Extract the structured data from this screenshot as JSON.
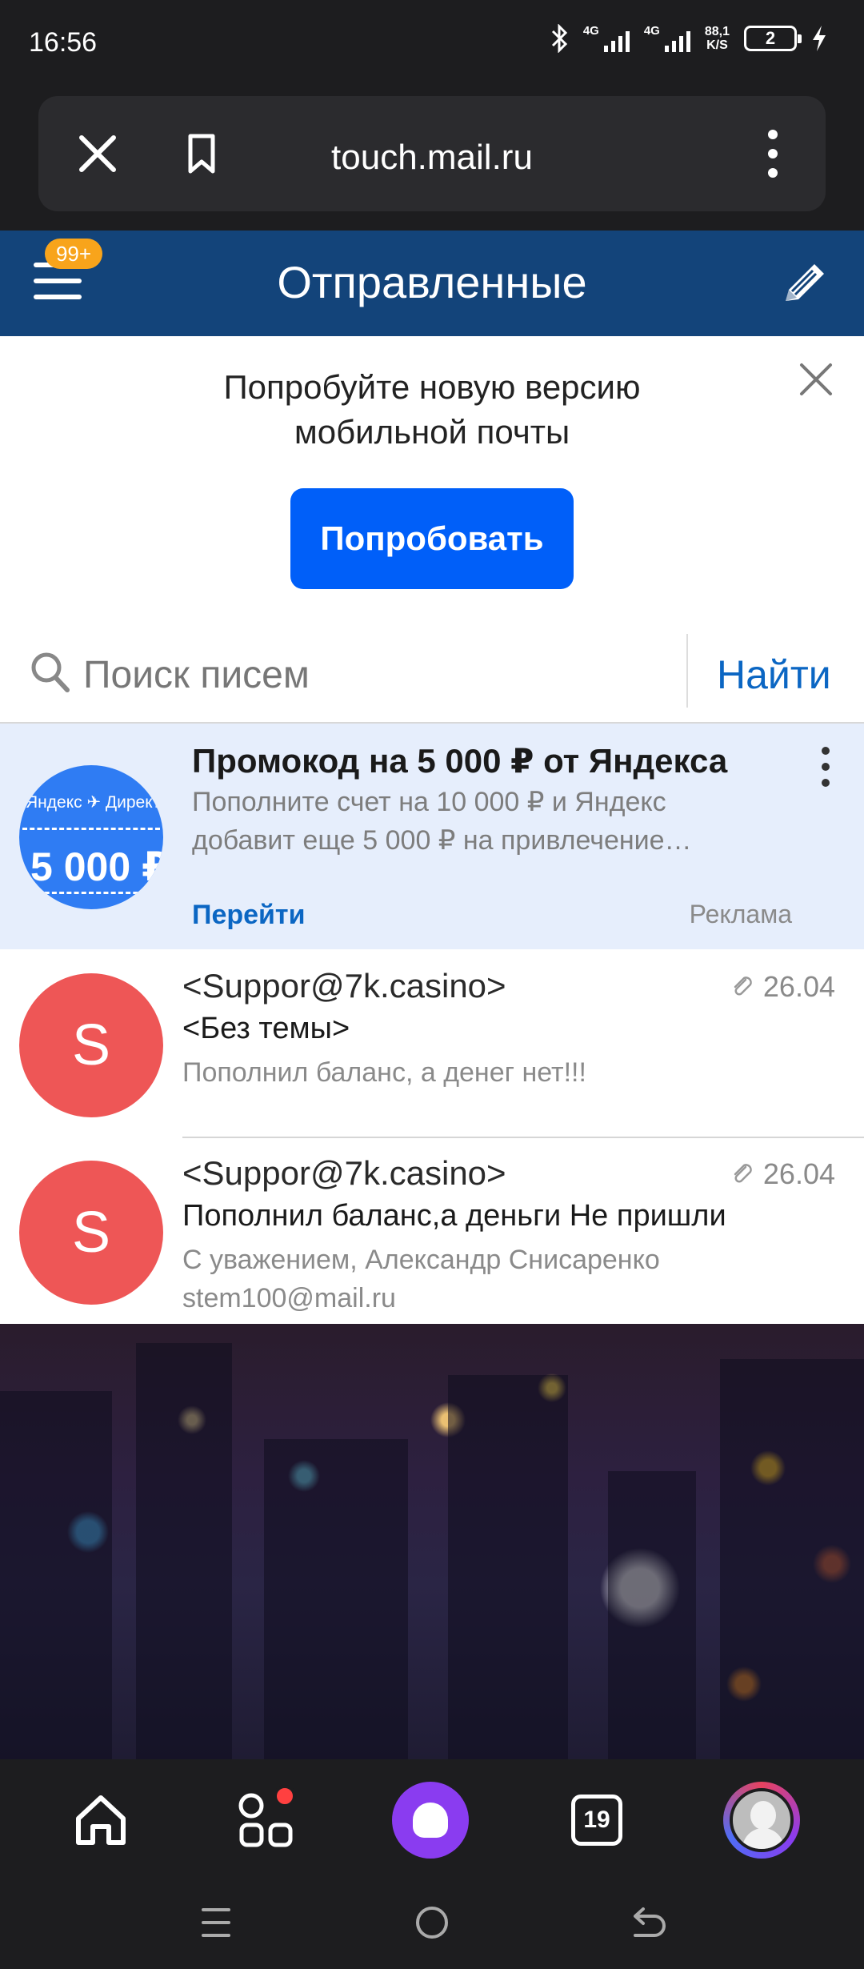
{
  "status_bar": {
    "time": "16:56",
    "network_1": "4G",
    "network_2": "4G",
    "speed_value": "88,1",
    "speed_unit": "K/S",
    "battery": "2"
  },
  "browser": {
    "url": "touch.mail.ru"
  },
  "header": {
    "badge": "99+",
    "title": "Отправленные",
    "color": "#13447a"
  },
  "promo": {
    "line1": "Попробуйте новую версию",
    "line2": "мобильной почты",
    "button": "Попробовать"
  },
  "search": {
    "placeholder": "Поиск писем",
    "button": "Найти"
  },
  "ad": {
    "thumb_brand": "Яндекс ✈ Директ",
    "thumb_amount": "5 000 ₽",
    "title": "Промокод на 5 000 ₽ от Яндекса",
    "text": "Пополните счет на 10 000 ₽ и Яндекс добавит еще 5 000 ₽ на привлечение…",
    "link": "Перейти",
    "label": "Реклама"
  },
  "messages": [
    {
      "avatar_letter": "S",
      "from": "<Suppor@7k.casino>",
      "date": "26.04",
      "subject": "<Без темы>",
      "preview": "Пополнил баланс, а денег нет!!!"
    },
    {
      "avatar_letter": "S",
      "from": "<Suppor@7k.casino>",
      "date": "26.04",
      "subject": "Пополнил баланс,а деньги Не пришли",
      "preview": "С уважением, Александр Снисаренко stem100@mail.ru"
    }
  ],
  "bottom_nav": {
    "tabs_count": "19",
    "icons": [
      "home-icon",
      "apps-icon",
      "alice-icon",
      "tabs-icon",
      "profile-icon"
    ]
  },
  "colors": {
    "accent": "#005ff9",
    "link": "#0b66c3",
    "avatar": "#ee5656",
    "badge": "#f8a41b"
  }
}
